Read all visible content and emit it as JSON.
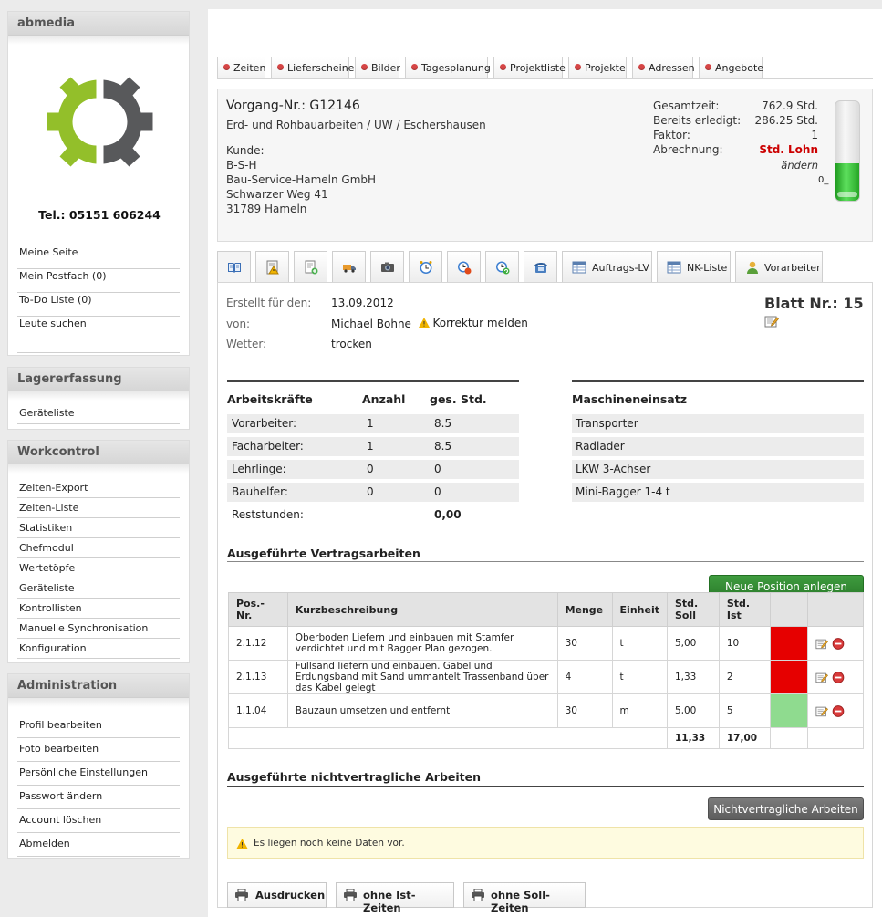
{
  "sidebar": {
    "brand": "abmedia",
    "tel": "Tel.: 05151 606244",
    "user_links": [
      "Meine Seite",
      "Mein Postfach (0)",
      "To-Do Liste (0)",
      "Leute suchen"
    ],
    "lager": {
      "title": "Lagererfassung",
      "links": [
        "Geräteliste"
      ]
    },
    "workcontrol": {
      "title": "Workcontrol",
      "links": [
        "Zeiten-Export",
        "Zeiten-Liste",
        "Statistiken",
        "Chefmodul",
        "Wertetöpfe",
        "Geräteliste",
        "Kontrollisten",
        "Manuelle Synchronisation",
        "Konfiguration"
      ]
    },
    "admin": {
      "title": "Administration",
      "links": [
        "Profil bearbeiten",
        "Foto bearbeiten",
        "Persönliche Einstellungen",
        "Passwort ändern",
        "Account löschen",
        "Abmelden"
      ]
    }
  },
  "topnav": [
    "Zeiten",
    "Lieferscheine",
    "Bilder",
    "Tagesplanung",
    "Projektliste",
    "Projekte",
    "Adressen",
    "Angebote"
  ],
  "vorgang": {
    "title": "Vorgang-Nr.: G12146",
    "subtitle": "Erd- und Rohbauarbeiten / UW / Eschershausen",
    "kunde_label": "Kunde:",
    "kunde_lines": [
      "B-S-H",
      "Bau-Service-Hameln GmbH",
      "Schwarzer Weg 41",
      "31789 Hameln"
    ],
    "gesamtzeit_label": "Gesamtzeit:",
    "gesamtzeit": "762.9 Std.",
    "erledigt_label": "Bereits erledigt:",
    "erledigt": "286.25 Std.",
    "faktor_label": "Faktor:",
    "faktor": "1",
    "abrechnung_label": "Abrechnung:",
    "abrechnung": "Std. Lohn",
    "aendern": "ändern",
    "gauge_label": "0",
    "gauge_fraction": 0.375,
    "gauge_color": "#3cc43c"
  },
  "tabs": {
    "icon_tabs": [
      "book-icon",
      "warning-doc-icon",
      "add-doc-icon",
      "truck-icon",
      "camera-icon",
      "clock-icon",
      "clock-stop-icon",
      "clock-refresh-icon",
      "phone-icon"
    ],
    "auftrags_lv": "Auftrags-LV",
    "nk_liste": "NK-Liste",
    "vorarbeiter": "Vorarbeiter"
  },
  "blatt": {
    "erstellt_label": "Erstellt für den:",
    "erstellt": "13.09.2012",
    "von_label": "von:",
    "von": "Michael Bohne",
    "korrektur": "Korrektur melden",
    "wetter_label": "Wetter:",
    "wetter": "trocken",
    "blatt_nr": "Blatt Nr.: 15"
  },
  "arbeitskraefte": {
    "headers": [
      "Arbeitskräfte",
      "Anzahl",
      "ges. Std."
    ],
    "rows": [
      [
        "Vorarbeiter:",
        "1",
        "8.5"
      ],
      [
        "Facharbeiter:",
        "1",
        "8.5"
      ],
      [
        "Lehrlinge:",
        "0",
        "0"
      ],
      [
        "Bauhelfer:",
        "0",
        "0"
      ]
    ],
    "rest_label": "Reststunden:",
    "rest_value": "0,00"
  },
  "maschinen": {
    "header": "Maschineneinsatz",
    "rows": [
      "Transporter",
      "Radlader",
      "LKW 3-Achser",
      "Mini-Bagger 1-4 t"
    ]
  },
  "vertrag": {
    "title": "Ausgeführte Vertragsarbeiten",
    "new_button": "Neue Position anlegen",
    "headers": [
      "Pos.-Nr.",
      "Kurzbeschreibung",
      "Menge",
      "Einheit",
      "Std. Soll",
      "Std. Ist"
    ],
    "rows": [
      {
        "pos": "2.1.12",
        "desc": "Oberboden Liefern und einbauen mit Stamfer verdichtet und mit Bagger Plan gezogen.",
        "menge": "30",
        "einheit": "t",
        "soll": "5,00",
        "ist": "10",
        "status_color": "#e60000"
      },
      {
        "pos": "2.1.13",
        "desc": "Füllsand liefern und einbauen. Gabel und Erdungsband mit Sand ummantelt Trassenband über das Kabel gelegt",
        "menge": "4",
        "einheit": "t",
        "soll": "1,33",
        "ist": "2",
        "status_color": "#e60000"
      },
      {
        "pos": "1.1.04",
        "desc": "Bauzaun umsetzen und entfernt",
        "menge": "30",
        "einheit": "m",
        "soll": "5,00",
        "ist": "5",
        "status_color": "#8fdb8f"
      }
    ],
    "sum_soll": "11,33",
    "sum_ist": "17,00"
  },
  "nicht": {
    "title": "Ausgeführte nichtvertragliche Arbeiten",
    "button": "Nichtvertragliche Arbeiten",
    "empty": "Es liegen noch keine Daten vor."
  },
  "print": {
    "b1": "Ausdrucken",
    "b2": "ohne Ist-Zeiten",
    "b3": "ohne Soll-Zeiten"
  }
}
